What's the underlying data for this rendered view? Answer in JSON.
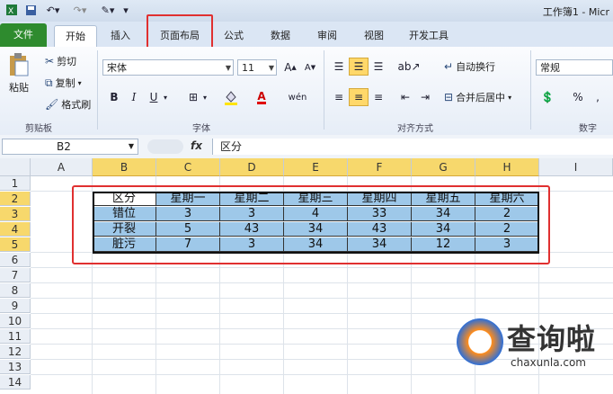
{
  "window_title": "工作簿1 - Micr",
  "quick_access": {
    "save_icon": "save-icon",
    "undo_icon": "undo-icon",
    "redo_icon": "redo-icon",
    "customize_icon": "customize-icon"
  },
  "tabs": [
    "文件",
    "开始",
    "插入",
    "页面布局",
    "公式",
    "数据",
    "审阅",
    "视图",
    "开发工具"
  ],
  "ribbon": {
    "clipboard": {
      "paste": "粘贴",
      "cut": "剪切",
      "copy": "复制",
      "format_painter": "格式刷",
      "group_label": "剪贴板"
    },
    "font": {
      "font_name": "宋体",
      "font_size": "11",
      "bold": "B",
      "italic": "I",
      "underline": "U",
      "group_label": "字体"
    },
    "alignment": {
      "wrap_text": "自动换行",
      "merge_center": "合并后居中",
      "group_label": "对齐方式"
    },
    "number": {
      "format": "常规",
      "percent": "%",
      "comma": ",",
      "group_label": "数字"
    }
  },
  "formula_bar": {
    "name_box": "B2",
    "fx": "fx",
    "content": "区分"
  },
  "columns": [
    "A",
    "B",
    "C",
    "D",
    "E",
    "F",
    "G",
    "H",
    "I"
  ],
  "rows": [
    "1",
    "2",
    "3",
    "4",
    "5",
    "6",
    "7",
    "8",
    "9",
    "10",
    "11",
    "12",
    "13",
    "14"
  ],
  "table": {
    "header": [
      "区分",
      "星期一",
      "星期二",
      "星期三",
      "星期四",
      "星期五",
      "星期六"
    ],
    "body": [
      [
        "错位",
        "3",
        "3",
        "4",
        "33",
        "34",
        "2"
      ],
      [
        "开裂",
        "5",
        "43",
        "34",
        "43",
        "34",
        "2"
      ],
      [
        "脏污",
        "7",
        "3",
        "34",
        "34",
        "12",
        "3"
      ]
    ]
  },
  "watermark": {
    "brand": "查询啦",
    "site": "chaxunla.com"
  },
  "colors": {
    "file_tab": "#2e8b2e",
    "highlight_red": "#e03030",
    "table_fill": "#9ec8e9",
    "selected_header": "#f7d86c"
  }
}
